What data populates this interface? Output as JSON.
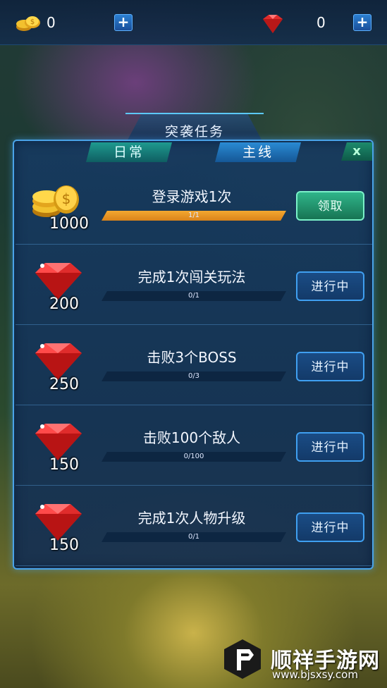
{
  "topbar": {
    "coins": "0",
    "gems": "0",
    "plus_label": "+"
  },
  "panel": {
    "title": "突袭任务",
    "tab_daily": "日常",
    "tab_main": "主线",
    "close_label": "x"
  },
  "colors": {
    "accent": "#4aa3e8",
    "progress": "#f4a830",
    "claim": "#2fb58a"
  },
  "tasks": [
    {
      "reward_type": "coin-icon",
      "reward": "1000",
      "name": "登录游戏1次",
      "progress_text": "1/1",
      "progress": 1.0,
      "button": "领取",
      "state": "claim"
    },
    {
      "reward_type": "gem-icon",
      "reward": "200",
      "name": "完成1次闯关玩法",
      "progress_text": "0/1",
      "progress": 0.0,
      "button": "进行中",
      "state": "progress"
    },
    {
      "reward_type": "gem-icon",
      "reward": "250",
      "name": "击败3个BOSS",
      "progress_text": "0/3",
      "progress": 0.0,
      "button": "进行中",
      "state": "progress"
    },
    {
      "reward_type": "gem-icon",
      "reward": "150",
      "name": "击败100个敌人",
      "progress_text": "0/100",
      "progress": 0.0,
      "button": "进行中",
      "state": "progress"
    },
    {
      "reward_type": "gem-icon",
      "reward": "150",
      "name": "完成1次人物升级",
      "progress_text": "0/1",
      "progress": 0.0,
      "button": "进行中",
      "state": "progress"
    }
  ],
  "watermark": {
    "name": "顺祥手游网",
    "url": "www.bjsxsy.com"
  }
}
